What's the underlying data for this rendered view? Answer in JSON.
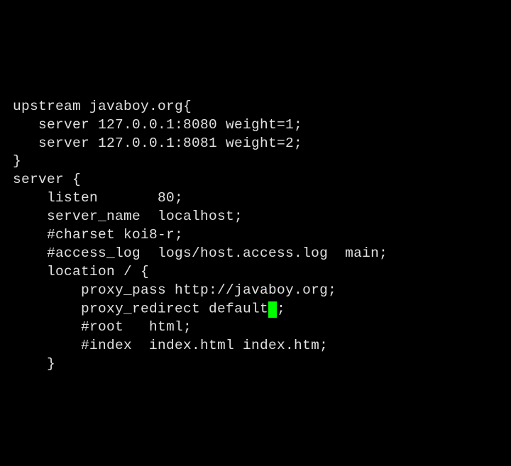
{
  "lines": {
    "l0": "upstream javaboy.org{",
    "l1": "   server 127.0.0.1:8080 weight=1;",
    "l2": "   server 127.0.0.1:8081 weight=2;",
    "l3": "}",
    "l4": "server {",
    "l5": "    listen       80;",
    "l6": "    server_name  localhost;",
    "l7": "",
    "l8": "    #charset koi8-r;",
    "l9": "",
    "l10": "    #access_log  logs/host.access.log  main;",
    "l11": "",
    "l12": "    location / {",
    "l13": "        proxy_pass http://javaboy.org;",
    "l14a": "        proxy_redirect default",
    "l14b": ";",
    "l15": "        #root   html;",
    "l16": "        #index  index.html index.htm;",
    "l17": "    }"
  }
}
